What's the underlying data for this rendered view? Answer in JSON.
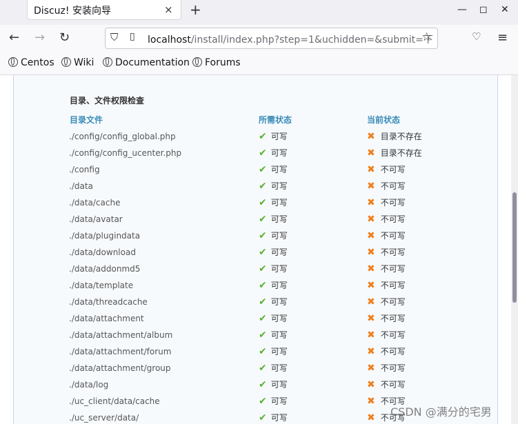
{
  "browser": {
    "tab_title": "Discuz! 安装向导",
    "tab_close": "×",
    "new_tab": "+",
    "url_host": "localhost",
    "url_path": "/install/index.php?step=1&uchidden=&submit=下",
    "bookmarks": [
      "Centos",
      "Wiki",
      "Documentation",
      "Forums"
    ]
  },
  "page": {
    "section_title": "目录、文件权限检查",
    "headers": {
      "path": "目录文件",
      "required": "所需状态",
      "current": "当前状态"
    },
    "rows": [
      {
        "path": "./config/config_global.php",
        "required": "可写",
        "current": "目录不存在"
      },
      {
        "path": "./config/config_ucenter.php",
        "required": "可写",
        "current": "目录不存在"
      },
      {
        "path": "./config",
        "required": "可写",
        "current": "不可写"
      },
      {
        "path": "./data",
        "required": "可写",
        "current": "不可写"
      },
      {
        "path": "./data/cache",
        "required": "可写",
        "current": "不可写"
      },
      {
        "path": "./data/avatar",
        "required": "可写",
        "current": "不可写"
      },
      {
        "path": "./data/plugindata",
        "required": "可写",
        "current": "不可写"
      },
      {
        "path": "./data/download",
        "required": "可写",
        "current": "不可写"
      },
      {
        "path": "./data/addonmd5",
        "required": "可写",
        "current": "不可写"
      },
      {
        "path": "./data/template",
        "required": "可写",
        "current": "不可写"
      },
      {
        "path": "./data/threadcache",
        "required": "可写",
        "current": "不可写"
      },
      {
        "path": "./data/attachment",
        "required": "可写",
        "current": "不可写"
      },
      {
        "path": "./data/attachment/album",
        "required": "可写",
        "current": "不可写"
      },
      {
        "path": "./data/attachment/forum",
        "required": "可写",
        "current": "不可写"
      },
      {
        "path": "./data/attachment/group",
        "required": "可写",
        "current": "不可写"
      },
      {
        "path": "./data/log",
        "required": "可写",
        "current": "不可写"
      },
      {
        "path": "./uc_client/data/cache",
        "required": "可写",
        "current": "不可写"
      },
      {
        "path": "./uc_server/data/",
        "required": "可写",
        "current": "不可写"
      }
    ]
  },
  "watermark": "CSDN @满分的宅男",
  "colors": {
    "ok": "#5bb12f",
    "error": "#f07f1d",
    "header": "#3a8bb7"
  }
}
